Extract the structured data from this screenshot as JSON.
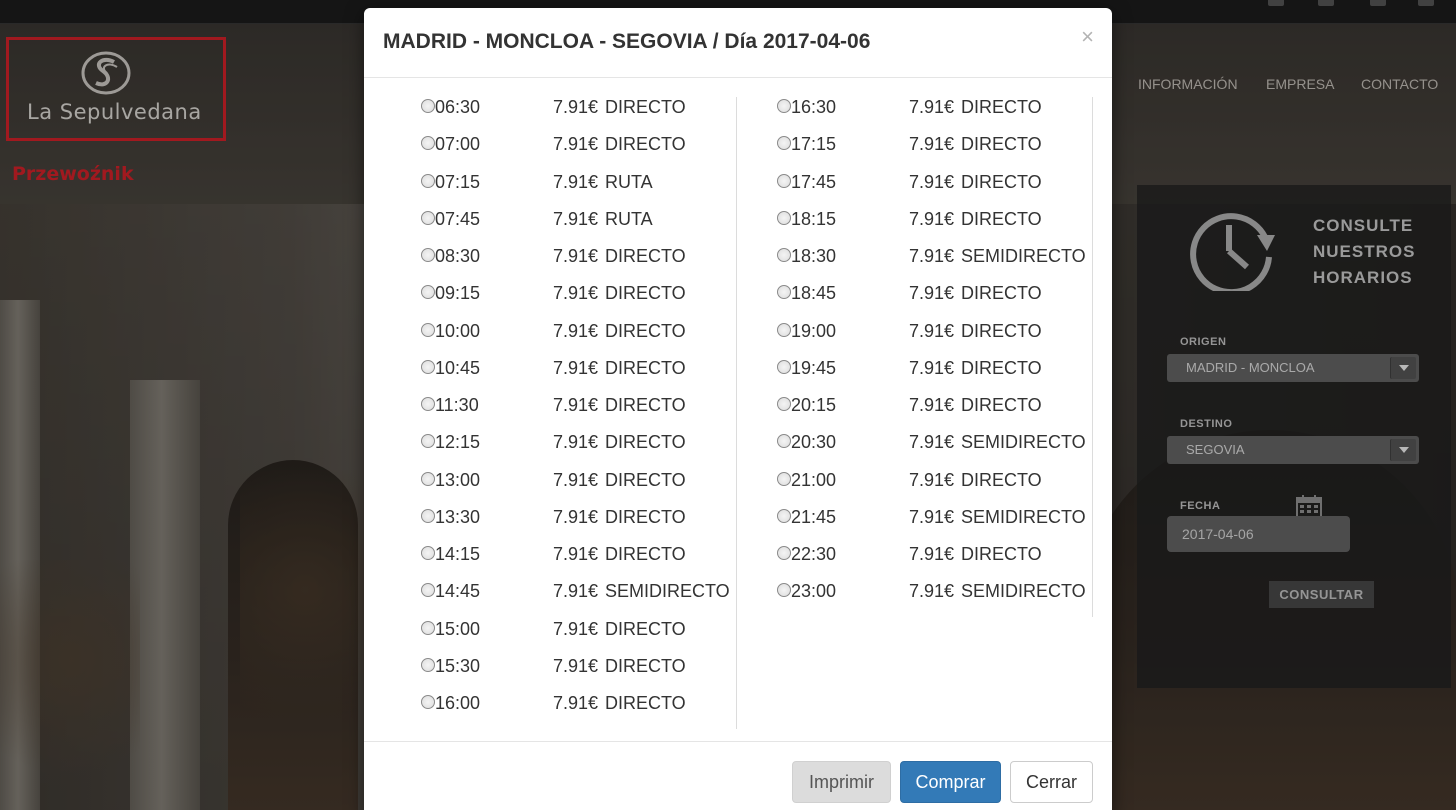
{
  "background": {
    "logo_text": "La Sepulvedana",
    "carrier_label": "Przewoźnik",
    "nav": [
      "INFORMACIÓN",
      "EMPRESA",
      "CONTACTO"
    ],
    "panel": {
      "title_lines": [
        "CONSULTE",
        "NUESTROS",
        "HORARIOS"
      ],
      "origin_label": "ORIGEN",
      "origin_value": "MADRID - MONCLOA",
      "destination_label": "DESTINO",
      "destination_value": "SEGOVIA",
      "date_label": "FECHA",
      "date_value": "2017-04-06",
      "submit_label": "CONSULTAR"
    }
  },
  "modal": {
    "title": "MADRID - MONCLOA - SEGOVIA / Día 2017-04-06",
    "close_glyph": "×",
    "schedule_left": [
      {
        "time": "06:30",
        "price": "7.91€",
        "type": "DIRECTO"
      },
      {
        "time": "07:00",
        "price": "7.91€",
        "type": "DIRECTO"
      },
      {
        "time": "07:15",
        "price": "7.91€",
        "type": "RUTA"
      },
      {
        "time": "07:45",
        "price": "7.91€",
        "type": "RUTA"
      },
      {
        "time": "08:30",
        "price": "7.91€",
        "type": "DIRECTO"
      },
      {
        "time": "09:15",
        "price": "7.91€",
        "type": "DIRECTO"
      },
      {
        "time": "10:00",
        "price": "7.91€",
        "type": "DIRECTO"
      },
      {
        "time": "10:45",
        "price": "7.91€",
        "type": "DIRECTO"
      },
      {
        "time": "11:30",
        "price": "7.91€",
        "type": "DIRECTO"
      },
      {
        "time": "12:15",
        "price": "7.91€",
        "type": "DIRECTO"
      },
      {
        "time": "13:00",
        "price": "7.91€",
        "type": "DIRECTO"
      },
      {
        "time": "13:30",
        "price": "7.91€",
        "type": "DIRECTO"
      },
      {
        "time": "14:15",
        "price": "7.91€",
        "type": "DIRECTO"
      },
      {
        "time": "14:45",
        "price": "7.91€",
        "type": "SEMIDIRECTO"
      },
      {
        "time": "15:00",
        "price": "7.91€",
        "type": "DIRECTO"
      },
      {
        "time": "15:30",
        "price": "7.91€",
        "type": "DIRECTO"
      },
      {
        "time": "16:00",
        "price": "7.91€",
        "type": "DIRECTO"
      }
    ],
    "schedule_right": [
      {
        "time": "16:30",
        "price": "7.91€",
        "type": "DIRECTO"
      },
      {
        "time": "17:15",
        "price": "7.91€",
        "type": "DIRECTO"
      },
      {
        "time": "17:45",
        "price": "7.91€",
        "type": "DIRECTO"
      },
      {
        "time": "18:15",
        "price": "7.91€",
        "type": "DIRECTO"
      },
      {
        "time": "18:30",
        "price": "7.91€",
        "type": "SEMIDIRECTO"
      },
      {
        "time": "18:45",
        "price": "7.91€",
        "type": "DIRECTO"
      },
      {
        "time": "19:00",
        "price": "7.91€",
        "type": "DIRECTO"
      },
      {
        "time": "19:45",
        "price": "7.91€",
        "type": "DIRECTO"
      },
      {
        "time": "20:15",
        "price": "7.91€",
        "type": "DIRECTO"
      },
      {
        "time": "20:30",
        "price": "7.91€",
        "type": "SEMIDIRECTO"
      },
      {
        "time": "21:00",
        "price": "7.91€",
        "type": "DIRECTO"
      },
      {
        "time": "21:45",
        "price": "7.91€",
        "type": "SEMIDIRECTO"
      },
      {
        "time": "22:30",
        "price": "7.91€",
        "type": "DIRECTO"
      },
      {
        "time": "23:00",
        "price": "7.91€",
        "type": "SEMIDIRECTO"
      }
    ],
    "buttons": {
      "print": "Imprimir",
      "buy": "Comprar",
      "close": "Cerrar"
    }
  },
  "colors": {
    "primary_button": "#337ab7",
    "highlight_red": "#e0232b"
  }
}
